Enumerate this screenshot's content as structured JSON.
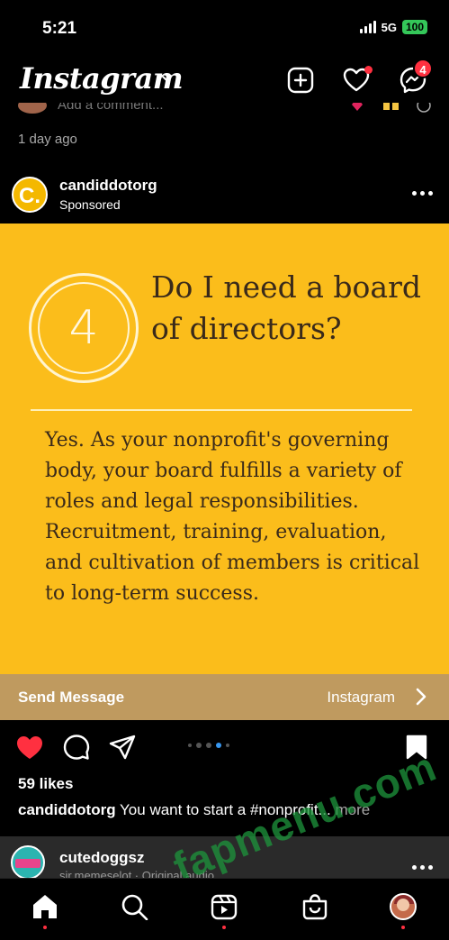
{
  "status_bar": {
    "time": "5:21",
    "network": "5G",
    "battery": "100"
  },
  "app_bar": {
    "brand": "Instagram",
    "messages_badge": "4"
  },
  "previous_post": {
    "comment_placeholder": "Add a comment...",
    "time_ago": "1 day ago"
  },
  "post": {
    "username": "candiddotorg",
    "sponsored_label": "Sponsored",
    "avatar_letter": "C.",
    "ad": {
      "number": "4",
      "question": "Do I need a board of directors?",
      "body": "Yes. As your nonprofit's governing body, your board fulfills a variety of roles and legal responsibilities. Recruitment, training, evaluation, and cultivation of members is critical to long-term success.",
      "background_color": "#fbbd1b"
    },
    "cta": {
      "label": "Send Message",
      "destination": "Instagram"
    },
    "carousel": {
      "total": 5,
      "active_index": 3
    },
    "likes": "59 likes",
    "caption": {
      "username": "candiddotorg",
      "text": "You want to start a #nonprofit...",
      "more": "more"
    }
  },
  "next_post": {
    "username": "cutedoggsz",
    "subtitle": "sir.memeselot · Original audio"
  },
  "bottom_nav": {
    "items": [
      "home-icon",
      "search-icon",
      "reels-icon",
      "shop-icon",
      "profile-avatar"
    ]
  },
  "watermark": "fapmenu.com",
  "colors": {
    "like_red": "#ff3040",
    "cta_bar": "#bf9a5f",
    "carousel_active": "#3897f0"
  }
}
